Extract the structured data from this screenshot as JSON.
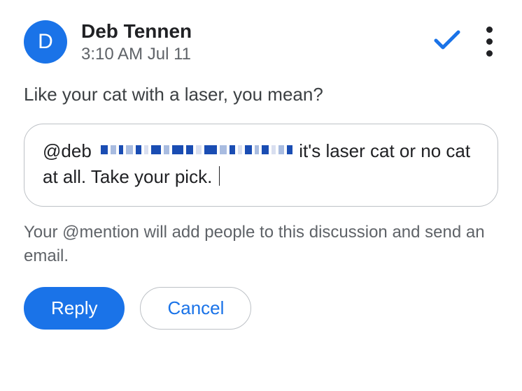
{
  "header": {
    "avatar_initial": "D",
    "name": "Deb Tennen",
    "timestamp": "3:10 AM Jul 11"
  },
  "comment": {
    "text": "Like your cat with a laser, you mean?"
  },
  "reply": {
    "mention": "@deb",
    "tail": "it's laser cat or no cat at all. Take your pick."
  },
  "helper": "Your @mention will add people to this discussion and send an email.",
  "buttons": {
    "reply": "Reply",
    "cancel": "Cancel"
  },
  "colors": {
    "accent": "#1a73e8"
  }
}
